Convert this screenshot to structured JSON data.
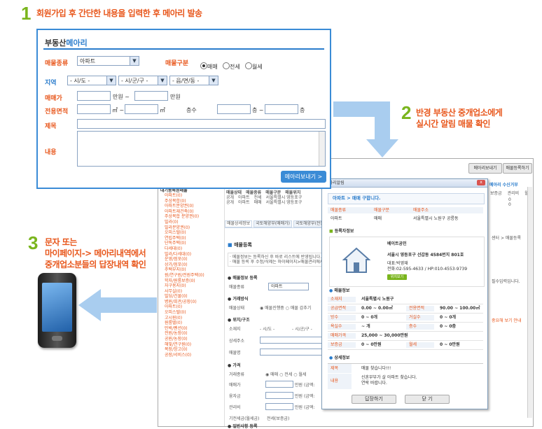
{
  "steps": [
    {
      "num": "1",
      "text": "회원가입 후 간단한 내용을 입력한 후 메아리 발송"
    },
    {
      "num": "2",
      "line1": "반경 부동산 중개업소에게",
      "line2": "실시간 알림 매물 확인"
    },
    {
      "num": "3",
      "line1": "문자 또는",
      "line2": "마이페이지-> 메아리내역에서",
      "line3": "중개업소분들의 답장내역 확인"
    }
  ],
  "form": {
    "title_prefix": "부동산",
    "title_accent": "메아리",
    "property_type_label": "매물종류",
    "property_type_value": "아파트",
    "deal_type_label": "매물구분",
    "deal_options": [
      "매매",
      "전세",
      "월세"
    ],
    "deal_selected": "매매",
    "region_label": "지역",
    "region_selects": [
      "- 시/도 -",
      "- 시/군/구 -",
      "- 읍/면/동 -"
    ],
    "price_label": "매매가",
    "price_unit": "만원",
    "price_sep": "~",
    "area_label": "전용면적",
    "area_unit": "㎡",
    "floor_label": "층수",
    "floor_unit": "층",
    "subject_label": "제목",
    "content_label": "내용",
    "submit_button": "메아리보내기 >"
  },
  "back_window": {
    "top_buttons": [
      "메아리보내기",
      "매물등록하기"
    ],
    "right_header": "메아리 수신거부",
    "table_header": [
      "매물상태",
      "매물종류",
      "매물구분",
      "매물위치"
    ],
    "table_rows": [
      [
        "공개",
        "아파트",
        "전세",
        "서울특별시 영등포구"
      ],
      [
        "공개",
        "아파트",
        "매매",
        "서울특별시 영등포구"
      ]
    ],
    "tabs": [
      "매물상세정보",
      "국토해양부(매매가)",
      "국토해양부(전월세가)"
    ],
    "section_register": "매물등록",
    "notice_lines": [
      "· 메물정보는 등록하신 후 바로 리스트에 반영됩니다.",
      "· 매물 등록 후 수정/삭제는 마이페이지>매물관리에서 이"
    ],
    "sections": [
      "매물정보 등록",
      "거래방식",
      "위치/구조",
      "가격",
      "일반사항 등록"
    ],
    "fields": [
      "매물종류",
      "매물상태",
      "소재지",
      "상세주소",
      "매물명",
      "거래종류",
      "매매가",
      "융자금",
      "관리비",
      "기전세금(월세금)"
    ],
    "field_values": {
      "kind": "아파트",
      "region": [
        "- 시/도 -",
        "- 시/군/구 -"
      ],
      "deposit": "전세(보증금)"
    },
    "radio_groups": {
      "status": [
        "매물진행중",
        "매물 감추기"
      ],
      "deal": [
        "매매",
        "전세",
        "월세"
      ]
    },
    "price_hint": "만원 (금액:",
    "tree_root": "대기동록된매물",
    "tree_items": [
      "아파트(0)",
      "주상복합(0)",
      "아파트분양권(0)",
      "아파트재건축(0)",
      "주상복합 분양권(0)",
      "빌라(0)",
      "빌라분양권(0)",
      "오피스텔(0)",
      "연립주택(0)",
      "단독주택(0)",
      "다세대(0)",
      "빌라/다세대(0)",
      "운영/점포(0)",
      "상가/점포(0)",
      "주택부지(0)",
      "원/연구원/전원주택(0)",
      "학자/원룸보증(0)",
      "자구용지(0)",
      "사무실(0)",
      "빌딩/건물(0)",
      "병원/회관/공장(0)",
      "아파트(0)",
      "오피스텔(0)",
      "고시원(0)",
      "원룸텔(0)",
      "민박/펜션(0)",
      "전원/농장(0)",
      "공원/농장(0)",
      "해빛/연구원(0)",
      "목장/창고(0)",
      "공장/서비스(0)"
    ],
    "right_col_headers": [
      "보증금",
      "관리비",
      "월"
    ],
    "right_col_values": [
      "0",
      "0"
    ],
    "right_mid_text": "센터 > 매물등록",
    "right_note": "필수입력입니다.",
    "right_red": "중요해 보기 안내"
  },
  "popup": {
    "title": "메아리알림",
    "headline": "아파트 > 매매 구합니다.",
    "summary_headers": [
      "매물종류",
      "매물구분",
      "매물주소"
    ],
    "summary_values": [
      "아파트",
      "매매",
      "서울특별시 노원구 공릉동"
    ],
    "agent_section": "등록자정보",
    "agent_name": "베이트공인",
    "agent_address": "서울시 영등포구 선갑동 4584번지 801호",
    "agent_contact_name": "대표:박영재",
    "agent_phone": "전화:02-595-4633 / HP:010-4553-9739",
    "agent_button": "위치보기",
    "info_section": "매물정보",
    "info_rows": [
      [
        "소재지",
        "서울특별시 노원구",
        "",
        ""
      ],
      [
        "공급면적",
        "0.00 ~ 0.00㎡",
        "전용면적",
        "90.00 ~ 100.00㎡"
      ],
      [
        "방수",
        "0 ~ 0개",
        "거실수",
        "0 ~ 0개"
      ],
      [
        "욕실수",
        "~ 개",
        "층수",
        "0 ~ 0층"
      ],
      [
        "매매가격",
        "25,000 ~ 30,000만원",
        "",
        ""
      ],
      [
        "보증금",
        "0 ~ 0만원",
        "월세",
        "0 ~ 0만원"
      ]
    ],
    "detail_section": "상세정보",
    "detail_subject_label": "제목",
    "detail_subject": "매물 찾습니다!!!",
    "detail_content_label": "내용",
    "detail_content_1": "신혼부부가 살 아파트 찾습니다.",
    "detail_content_2": "연락 바랍니다.",
    "buttons": [
      "답장하기",
      "닫 기"
    ]
  },
  "colors": {
    "accent_green": "#7ab51d",
    "accent_orange": "#e8571c",
    "accent_blue": "#3a8bd6",
    "arrow": "#a9cdef"
  }
}
